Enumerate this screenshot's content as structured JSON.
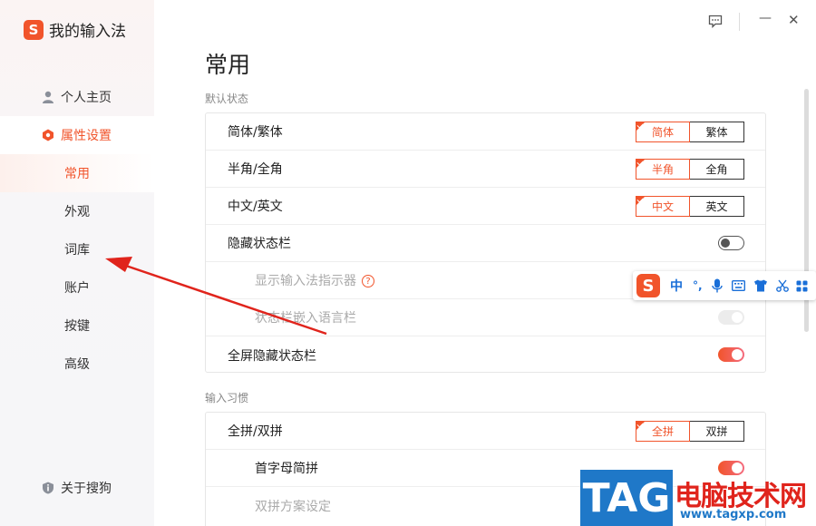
{
  "app": {
    "title": "我的输入法",
    "logo_letter": "S"
  },
  "sidebar": {
    "items": [
      {
        "label": "个人主页",
        "icon": "person-icon"
      },
      {
        "label": "属性设置",
        "icon": "hexagon-icon"
      }
    ],
    "subitems": [
      "常用",
      "外观",
      "词库",
      "账户",
      "按键",
      "高级"
    ],
    "about": "关于搜狗"
  },
  "window": {
    "feedback_icon": "chat-icon",
    "minimize": "—",
    "close": "✕"
  },
  "main": {
    "title": "常用",
    "section1": {
      "label": "默认状态",
      "rows": [
        {
          "label": "简体/繁体",
          "options": [
            "简体",
            "繁体"
          ],
          "selected": 0
        },
        {
          "label": "半角/全角",
          "options": [
            "半角",
            "全角"
          ],
          "selected": 0
        },
        {
          "label": "中文/英文",
          "options": [
            "中文",
            "英文"
          ],
          "selected": 0
        },
        {
          "label": "隐藏状态栏",
          "toggle": "off"
        },
        {
          "label": "显示输入法指示器",
          "help": "?",
          "toggle": "disabled"
        },
        {
          "label": "状态栏嵌入语言栏",
          "toggle": "disabled"
        },
        {
          "label": "全屏隐藏状态栏",
          "toggle": "on"
        }
      ]
    },
    "section2": {
      "label": "输入习惯",
      "rows": [
        {
          "label": "全拼/双拼",
          "options": [
            "全拼",
            "双拼"
          ],
          "selected": 0
        },
        {
          "label": "首字母简拼",
          "toggle": "on"
        },
        {
          "label": "双拼方案设定"
        }
      ]
    }
  },
  "ime_toolbar": {
    "logo_letter": "S",
    "mode": "中",
    "punct": "°,"
  },
  "watermark": {
    "tag": "TAG",
    "cn": "电脑技术网",
    "url": "www.tagxp.com"
  },
  "colors": {
    "accent": "#f1542b",
    "link_blue": "#1a6fd8"
  }
}
